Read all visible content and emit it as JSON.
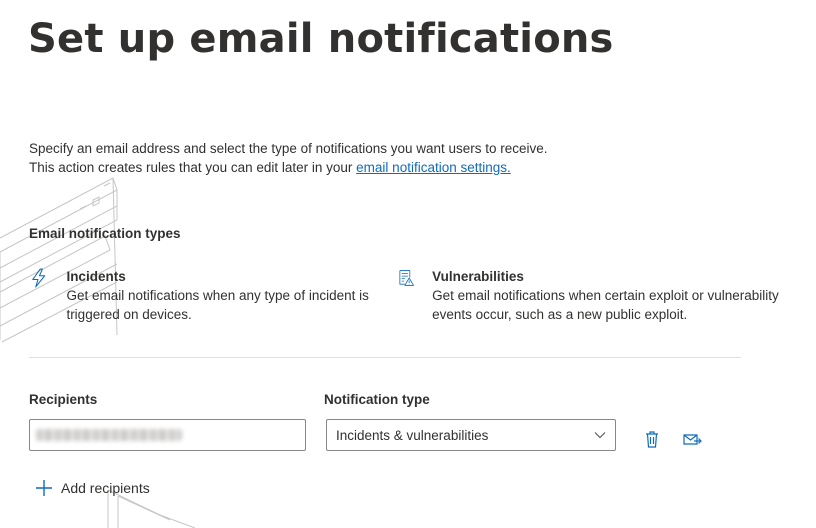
{
  "page": {
    "title": "Set up email notifications",
    "description_line1": "Specify an email address and select the type of notifications you want users to receive.",
    "description_line2_prefix": "This action creates rules that you can edit later in your ",
    "description_link": "email notification settings."
  },
  "notification_types": {
    "heading": "Email notification types",
    "items": [
      {
        "icon": "lightning-bolt-icon",
        "title": "Incidents",
        "description": "Get email notifications when any type of incident is triggered on devices."
      },
      {
        "icon": "vulnerability-report-icon",
        "title": "Vulnerabilities",
        "description": "Get email notifications when certain exploit or vulnerability events occur, such as a new public exploit."
      }
    ]
  },
  "form": {
    "recipients_label": "Recipients",
    "recipients_value": "",
    "notification_type_label": "Notification type",
    "notification_type_value": "Incidents & vulnerabilities",
    "add_recipients_label": "Add recipients"
  },
  "colors": {
    "accent": "#0f6cbd",
    "text": "#323130",
    "border": "#8a8886",
    "divider": "#e1dfdd"
  }
}
